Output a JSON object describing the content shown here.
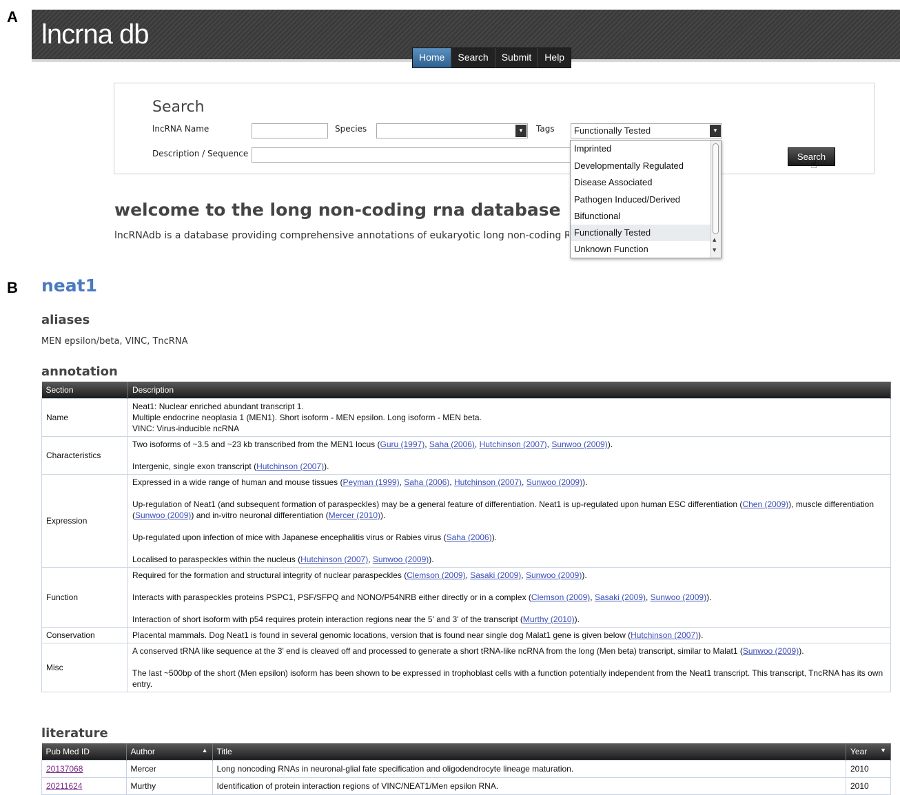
{
  "panel_a_letter": "A",
  "panel_b_letter": "B",
  "header": {
    "logo": "lncrna db",
    "nav": [
      "Home",
      "Search",
      "Submit",
      "Help"
    ],
    "active_nav": "Home"
  },
  "search": {
    "title": "Search",
    "lncrna_name_label": "lncRNA Name",
    "species_label": "Species",
    "tags_label": "Tags",
    "description_label": "Description / Sequence",
    "tags_selected": "Functionally Tested",
    "tags_options": [
      "Imprinted",
      "Developmentally Regulated",
      "Disease Associated",
      "Pathogen Induced/Derived",
      "Bifunctional",
      "Functionally Tested",
      "Unknown Function"
    ],
    "button": "Search"
  },
  "welcome": {
    "heading": "welcome to the long non-coding rna database",
    "intro": "lncRNAdb is a database providing comprehensive annotations of eukaryotic long non-coding RNA"
  },
  "gene": {
    "name": "neat1",
    "aliases_heading": "aliases",
    "aliases": "MEN epsilon/beta, VINC, TncRNA",
    "annotation_heading": "annotation",
    "annotation_columns": [
      "Section",
      "Description"
    ],
    "annotation": [
      {
        "section": "Name",
        "paragraphs": [
          [
            {
              "t": "Neat1: Nuclear enriched abundant transcript 1."
            }
          ],
          [
            {
              "t": "Multiple endocrine neoplasia 1 (MEN1). Short isoform - MEN epsilon. Long isoform - MEN beta."
            }
          ],
          [
            {
              "t": "VINC: Virus-inducible ncRNA"
            }
          ]
        ],
        "tight": true
      },
      {
        "section": "Characteristics",
        "paragraphs": [
          [
            {
              "t": "Two isoforms of ~3.5 and ~23 kb transcribed from the MEN1 locus ("
            },
            {
              "c": "Guru (1997)"
            },
            {
              "t": ", "
            },
            {
              "c": "Saha (2006)"
            },
            {
              "t": ", "
            },
            {
              "c": "Hutchinson (2007)"
            },
            {
              "t": ", "
            },
            {
              "c": "Sunwoo (2009)"
            },
            {
              "t": ")."
            }
          ],
          [
            {
              "t": "Intergenic, single exon transcript ("
            },
            {
              "c": "Hutchinson (2007)"
            },
            {
              "t": ")."
            }
          ]
        ]
      },
      {
        "section": "Expression",
        "paragraphs": [
          [
            {
              "t": "Expressed in a wide range of human and mouse tissues ("
            },
            {
              "c": "Peyman (1999)"
            },
            {
              "t": ", "
            },
            {
              "c": "Saha (2006)"
            },
            {
              "t": ", "
            },
            {
              "c": "Hutchinson (2007)"
            },
            {
              "t": ", "
            },
            {
              "c": "Sunwoo (2009)"
            },
            {
              "t": ")."
            }
          ],
          [
            {
              "t": "Up-regulation of Neat1 (and subsequent formation of paraspeckles) may be a general feature of differentiation. Neat1 is up-regulated upon human ESC differentiation ("
            },
            {
              "c": "Chen (2009)"
            },
            {
              "t": "), muscle differentiation ("
            },
            {
              "c": "Sunwoo (2009)"
            },
            {
              "t": ") and in-vitro neuronal differentiation ("
            },
            {
              "c": "Mercer (2010)"
            },
            {
              "t": ")."
            }
          ],
          [
            {
              "t": "Up-regulated upon infection of mice with Japanese encephalitis virus or Rabies virus ("
            },
            {
              "c": "Saha (2006)"
            },
            {
              "t": ")."
            }
          ],
          [
            {
              "t": "Localised to paraspeckles within the nucleus ("
            },
            {
              "c": "Hutchinson (2007)"
            },
            {
              "t": ", "
            },
            {
              "c": "Sunwoo (2009)"
            },
            {
              "t": ")."
            }
          ]
        ]
      },
      {
        "section": "Function",
        "paragraphs": [
          [
            {
              "t": "Required for the formation and structural integrity of nuclear paraspeckles ("
            },
            {
              "c": "Clemson (2009)"
            },
            {
              "t": ", "
            },
            {
              "c": "Sasaki (2009)"
            },
            {
              "t": ", "
            },
            {
              "c": "Sunwoo (2009)"
            },
            {
              "t": ")."
            }
          ],
          [
            {
              "t": "Interacts with paraspeckles proteins PSPC1, PSF/SFPQ and NONO/P54NRB either directly or in a complex ("
            },
            {
              "c": "Clemson (2009)"
            },
            {
              "t": ", "
            },
            {
              "c": "Sasaki (2009)"
            },
            {
              "t": ", "
            },
            {
              "c": "Sunwoo (2009)"
            },
            {
              "t": ")."
            }
          ],
          [
            {
              "t": "Interaction of short isoform with p54 requires protein interaction regions near the 5' and 3' of the transcript ("
            },
            {
              "c": "Murthy (2010)"
            },
            {
              "t": ")."
            }
          ]
        ]
      },
      {
        "section": "Conservation",
        "paragraphs": [
          [
            {
              "t": "Placental mammals. Dog Neat1 is found in several genomic locations, version that is found near single dog Malat1 gene is given below ("
            },
            {
              "c": "Hutchinson (2007)"
            },
            {
              "t": ")."
            }
          ]
        ]
      },
      {
        "section": "Misc",
        "paragraphs": [
          [
            {
              "t": "A conserved tRNA like sequence at the 3' end is cleaved off and processed to generate a short tRNA-like ncRNA from the long (Men beta) transcript, similar to Malat1 ("
            },
            {
              "c": "Sunwoo (2009)"
            },
            {
              "t": ")."
            }
          ],
          [
            {
              "t": "The last ~500bp of the short (Men epsilon) isoform has been shown to be expressed in trophoblast cells with a function potentially independent from the Neat1 transcript. This transcript, TncRNA has its own entry."
            }
          ]
        ]
      }
    ],
    "literature_heading": "literature",
    "literature_columns": [
      "Pub Med ID",
      "Author",
      "Title",
      "Year"
    ],
    "literature": [
      {
        "pmid": "20137068",
        "author": "Mercer",
        "title": "Long noncoding RNAs in neuronal-glial fate specification and oligodendrocyte lineage maturation.",
        "year": "2010"
      },
      {
        "pmid": "20211624",
        "author": "Murthy",
        "title": "Identification of protein interaction regions of VINC/NEAT1/Men epsilon RNA.",
        "year": "2010"
      }
    ]
  }
}
